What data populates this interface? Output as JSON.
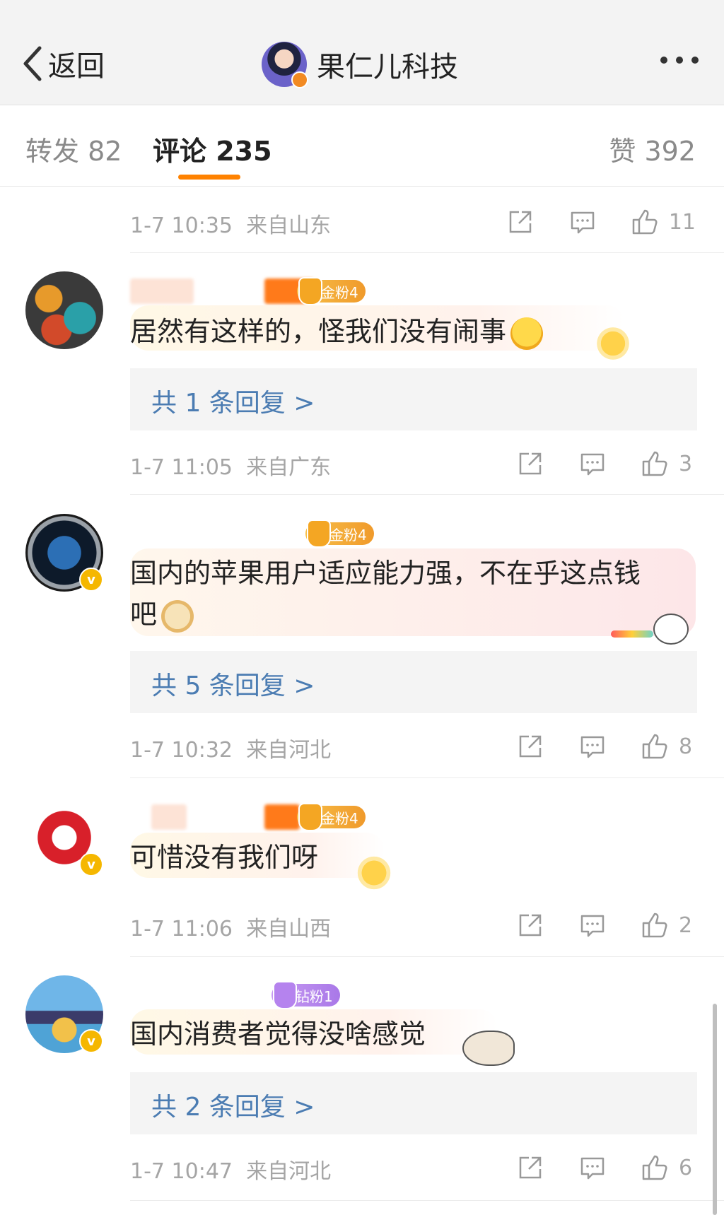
{
  "nav": {
    "back_label": "返回",
    "account_name": "果仁儿科技"
  },
  "tabs": {
    "repost": "转发 82",
    "comment": "评论 235",
    "like": "赞 392"
  },
  "colors": {
    "accent": "#ff8200",
    "reply_link": "#4b7cb2",
    "meta_gray": "#a5a5a5"
  },
  "top_meta": {
    "time": "1-7 10:35",
    "location": "来自山东",
    "likes": "11"
  },
  "comments": [
    {
      "fan_badge": "金粉4",
      "text": "居然有这样的，怪我们没有闹事",
      "emoji": "laughing-tears-emoji",
      "reply": "共 1 条回复 >",
      "time": "1-7 11:05",
      "location": "来自广东",
      "likes": "3"
    },
    {
      "fan_badge": "金粉4",
      "text_line1": "国内的苹果用户适应能力强，不在乎这点钱",
      "text_line2": "吧",
      "emoji": "doge-emoji",
      "reply": "共 5 条回复 >",
      "time": "1-7 10:32",
      "location": "来自河北",
      "likes": "8"
    },
    {
      "fan_badge": "金粉4",
      "text": "可惜没有我们呀",
      "time": "1-7 11:06",
      "location": "来自山西",
      "likes": "2"
    },
    {
      "fan_badge": "钻粉1",
      "text": "国内消费者觉得没啥感觉",
      "reply": "共 2 条回复 >",
      "time": "1-7 10:47",
      "location": "来自河北",
      "likes": "6"
    }
  ]
}
